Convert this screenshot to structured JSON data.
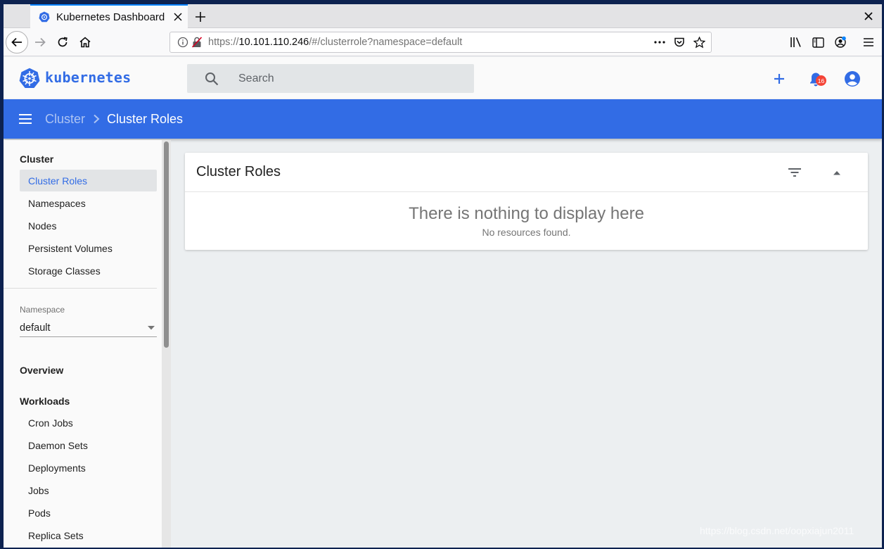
{
  "browser": {
    "tab_title": "Kubernetes Dashboard",
    "url_prefix": "https://",
    "url_host": "10.101.110.246",
    "url_path": "/#/clusterrole?namespace=default"
  },
  "header": {
    "brand": "kubernetes",
    "search_placeholder": "Search",
    "notification_count": "16"
  },
  "breadcrumb": {
    "parent": "Cluster",
    "current": "Cluster Roles"
  },
  "sidebar": {
    "cluster_heading": "Cluster",
    "cluster_items": [
      {
        "label": "Cluster Roles"
      },
      {
        "label": "Namespaces"
      },
      {
        "label": "Nodes"
      },
      {
        "label": "Persistent Volumes"
      },
      {
        "label": "Storage Classes"
      }
    ],
    "namespace_label": "Namespace",
    "namespace_value": "default",
    "overview_heading": "Overview",
    "workloads_heading": "Workloads",
    "workload_items": [
      {
        "label": "Cron Jobs"
      },
      {
        "label": "Daemon Sets"
      },
      {
        "label": "Deployments"
      },
      {
        "label": "Jobs"
      },
      {
        "label": "Pods"
      },
      {
        "label": "Replica Sets"
      }
    ]
  },
  "card": {
    "title": "Cluster Roles",
    "empty_title": "There is nothing to display here",
    "empty_subtitle": "No resources found."
  },
  "watermark": "https://blog.csdn.net/oopxiajun2011",
  "colors": {
    "accent": "#326ce5",
    "badge": "#f44336"
  }
}
